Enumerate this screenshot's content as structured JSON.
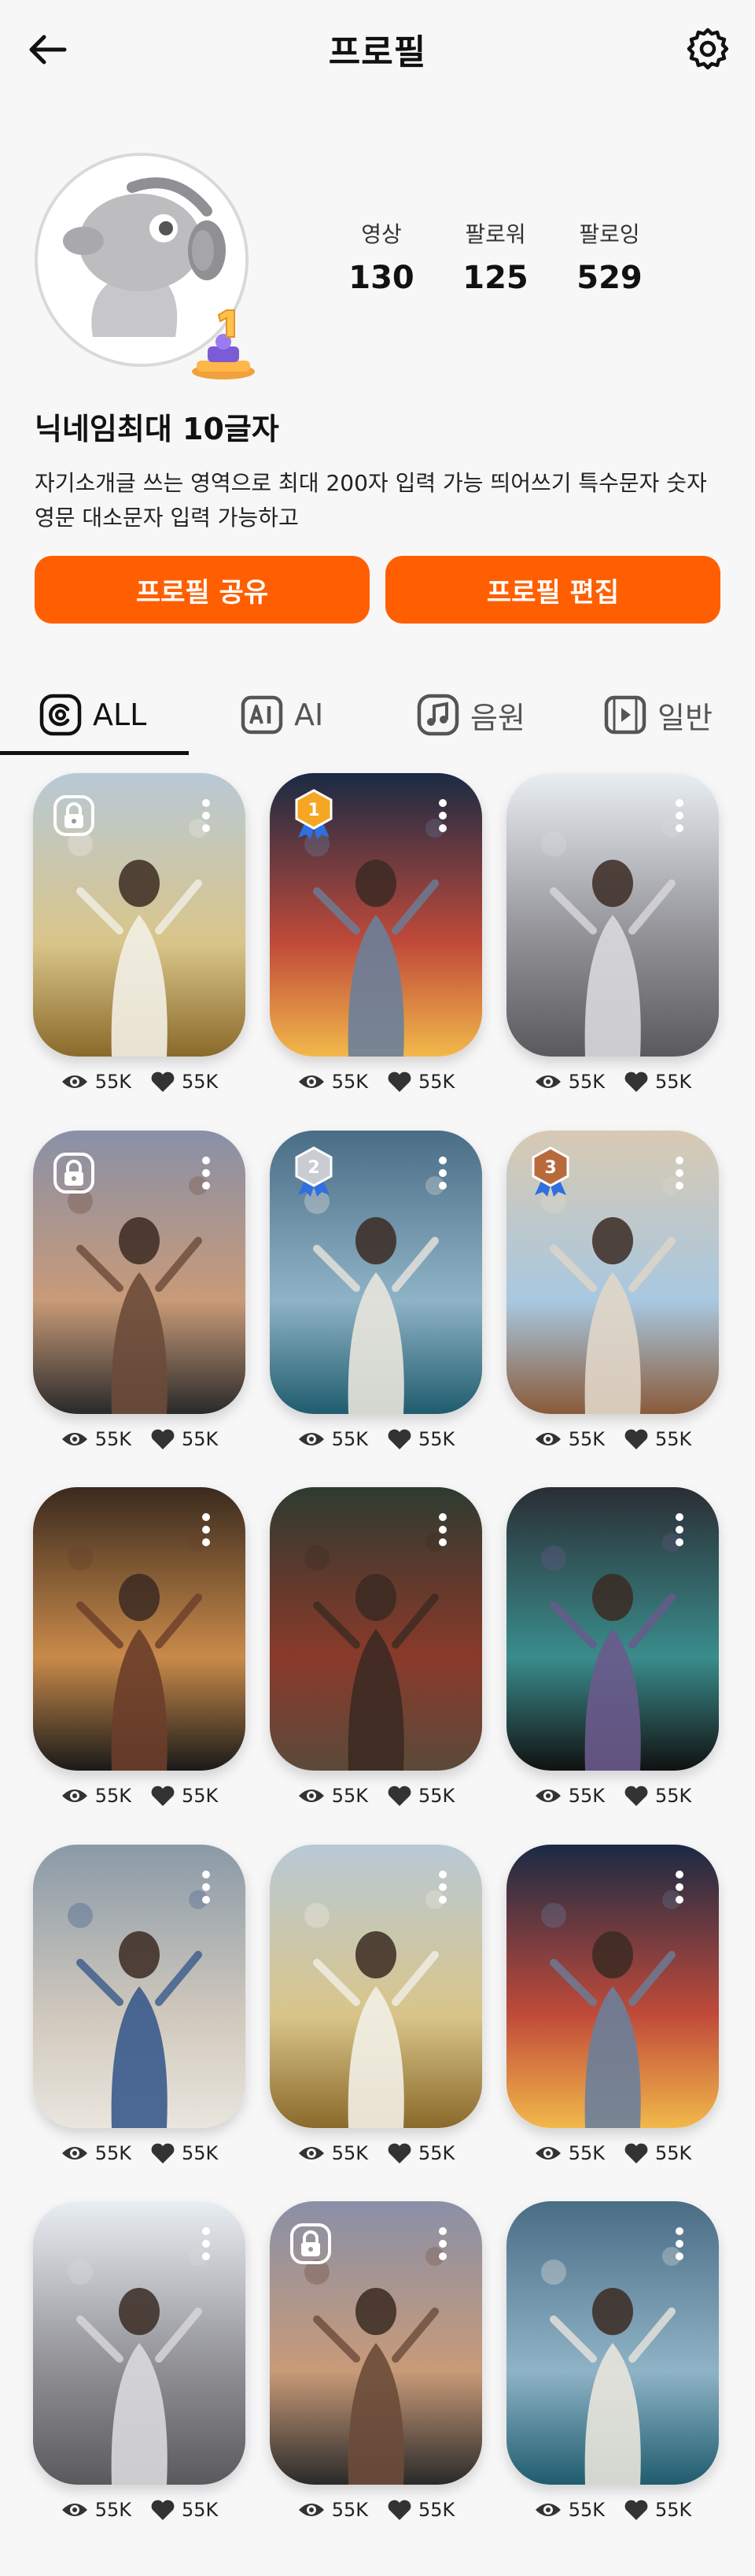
{
  "header": {
    "title": "프로필"
  },
  "profile": {
    "stats": [
      {
        "label": "영상",
        "value": "130"
      },
      {
        "label": "팔로워",
        "value": "125"
      },
      {
        "label": "팔로잉",
        "value": "529"
      }
    ],
    "nickname": "닉네임최대 10글자",
    "bio_line1": "자기소개글 쓰는 영역으로 최대 200자 입력 가능 띄어쓰기 특수문자 숫자",
    "bio_line2": "영문 대소문자 입력 가능하고",
    "share_label": "프로필 공유",
    "edit_label": "프로필 편집"
  },
  "tabs": [
    {
      "label": "ALL",
      "icon": "at-icon",
      "active": true
    },
    {
      "label": "AI",
      "icon": "ai-icon",
      "active": false
    },
    {
      "label": "음원",
      "icon": "music-icon",
      "active": false
    },
    {
      "label": "일반",
      "icon": "video-icon",
      "active": false
    }
  ],
  "videos": [
    {
      "views": "55K",
      "likes": "55K",
      "badge": "lock",
      "scene": "field"
    },
    {
      "views": "55K",
      "likes": "55K",
      "badge": "medal-1",
      "scene": "city-night"
    },
    {
      "views": "55K",
      "likes": "55K",
      "badge": "",
      "scene": "street"
    },
    {
      "views": "55K",
      "likes": "55K",
      "badge": "lock",
      "scene": "reeds"
    },
    {
      "views": "55K",
      "likes": "55K",
      "badge": "medal-2",
      "scene": "sea"
    },
    {
      "views": "55K",
      "likes": "55K",
      "badge": "medal-3",
      "scene": "arch"
    },
    {
      "views": "55K",
      "likes": "55K",
      "badge": "",
      "scene": "bokeh"
    },
    {
      "views": "55K",
      "likes": "55K",
      "badge": "",
      "scene": "green"
    },
    {
      "views": "55K",
      "likes": "55K",
      "badge": "",
      "scene": "teal"
    },
    {
      "views": "55K",
      "likes": "55K",
      "badge": "",
      "scene": "wall"
    },
    {
      "views": "55K",
      "likes": "55K",
      "badge": "",
      "scene": "field"
    },
    {
      "views": "55K",
      "likes": "55K",
      "badge": "",
      "scene": "city-night"
    },
    {
      "views": "55K",
      "likes": "55K",
      "badge": "",
      "scene": "street"
    },
    {
      "views": "55K",
      "likes": "55K",
      "badge": "lock",
      "scene": "reeds"
    },
    {
      "views": "55K",
      "likes": "55K",
      "badge": "",
      "scene": "sea"
    }
  ],
  "colors": {
    "accent": "#ff5f00",
    "medal_gold": "#f5a623",
    "medal_silver": "#c9ccd3",
    "medal_bronze": "#b96a3c"
  }
}
